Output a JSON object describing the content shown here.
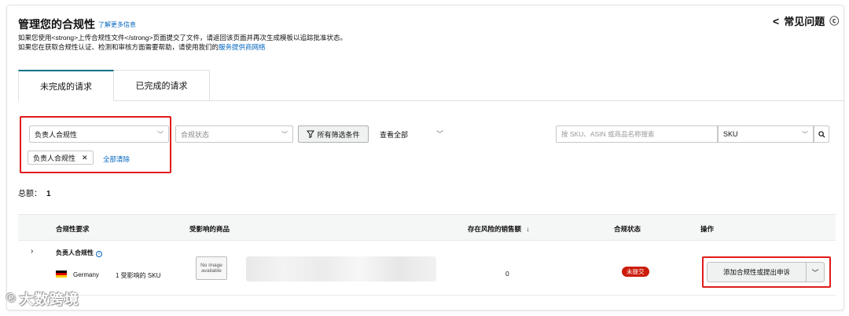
{
  "header": {
    "title": "管理您的合规性",
    "learn_more": "了解更多信息",
    "desc_line1": "如果您使用<strong>上传合规性文件</strong>页面提交了文件，请返回该页面并再次生成模板以追踪批准状态。",
    "desc_line2_prefix": "如果您在获取合规性认证、检测和审核方面需要帮助，请使用我们的",
    "desc_line2_link": "服务提供商网络",
    "faq": "常见问题"
  },
  "tabs": [
    {
      "label": "未完成的请求",
      "active": true
    },
    {
      "label": "已完成的请求",
      "active": false
    }
  ],
  "filters": {
    "responsible_select": "负责人合规性",
    "status_select_placeholder": "合规状态",
    "all_filters_button": "所有筛选条件",
    "view_all": "查看全部",
    "search_placeholder": "按 SKU、ASIN 或商品名称搜索",
    "search_type": "SKU",
    "active_chip": "负责人合规性",
    "clear_all": "全部清除"
  },
  "summary": {
    "total_label": "总额：",
    "total_value": "1"
  },
  "table": {
    "columns": [
      "合规性要求",
      "受影响的商品",
      "存在风险的销售额",
      "合规状态",
      "操作"
    ],
    "rows": [
      {
        "requirement": "负责人合规性",
        "country": "Germany",
        "affected_skus": "1 受影响的 SKU",
        "image_placeholder": "No image available",
        "sales_at_risk": "0",
        "status": "未提交",
        "action_label": "添加合规性或提出申诉"
      }
    ]
  },
  "colors": {
    "accent_link": "#0066c0",
    "highlight_red": "#e01b1b",
    "status_badge": "#cc1c0c",
    "tab_active": "#007185"
  },
  "watermark": {
    "text": "大数跨境"
  }
}
